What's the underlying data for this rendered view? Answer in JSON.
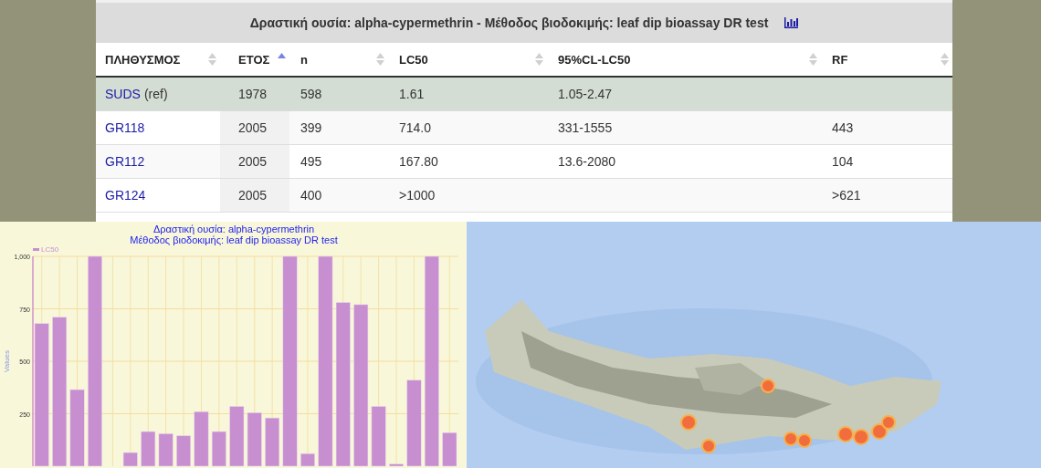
{
  "table_panel": {
    "title": "Δραστική ουσία: alpha-cypermethrin - Μέθοδος βιοδοκιμής: leaf dip bioassay DR test",
    "columns": [
      {
        "label": "ΠΛΗΘΥΣΜΟΣ",
        "sorted": false
      },
      {
        "label": "ΕΤΟΣ",
        "sorted": true
      },
      {
        "label": "n",
        "sorted": false
      },
      {
        "label": "LC50",
        "sorted": false
      },
      {
        "label": "95%CL-LC50",
        "sorted": false
      },
      {
        "label": "RF",
        "sorted": false
      }
    ],
    "rows": [
      {
        "population": "SUDS",
        "note": "(ref)",
        "year": "1978",
        "n": "598",
        "lc50": "1.61",
        "cl": "1.05-2.47",
        "rf": "",
        "selected": true
      },
      {
        "population": "GR118",
        "year": "2005",
        "n": "399",
        "lc50": "714.0",
        "cl": "331-1555",
        "rf": "443",
        "selected": false
      },
      {
        "population": "GR112",
        "year": "2005",
        "n": "495",
        "lc50": "167.80",
        "cl": "13.6-2080",
        "rf": "104",
        "selected": false
      },
      {
        "population": "GR124",
        "year": "2005",
        "n": "400",
        "lc50": ">1000",
        "cl": "",
        "rf": ">621",
        "selected": false
      }
    ]
  },
  "chart_panel": {
    "chart_data": {
      "type": "bar",
      "grid": true,
      "title": "Δραστική ουσία: alpha-cypermethrin\nΜέθοδος βιοδοκιμής: leaf dip bioassay DR test",
      "ylabel": "Values",
      "ylim": [
        0,
        1000
      ],
      "yticks": [
        {
          "value": 250,
          "label": "250"
        },
        {
          "value": 500,
          "label": "500"
        },
        {
          "value": 750,
          "label": "750"
        },
        {
          "value": 1000,
          "label": "1,000"
        }
      ],
      "series": [
        {
          "name": "LC50",
          "color": "#c88fd0",
          "values": [
            680,
            710,
            365,
            1000,
            null,
            65,
            165,
            155,
            145,
            260,
            165,
            285,
            255,
            230,
            1000,
            60,
            1000,
            780,
            770,
            285,
            10,
            410,
            1000,
            160
          ]
        }
      ]
    }
  }
}
